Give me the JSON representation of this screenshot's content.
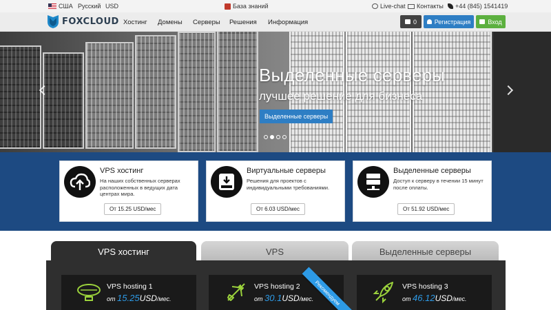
{
  "topbar": {
    "country": "США",
    "language": "Русский",
    "currency": "USD",
    "knowledge_base": "База знаний",
    "live_chat": "Live-chat",
    "contacts": "Контакты",
    "phone": "+44 (845) 1541419"
  },
  "nav": {
    "logo_text": "FOXCLOUD",
    "items": [
      "Хостинг",
      "Домены",
      "Серверы",
      "Решения",
      "Информация"
    ],
    "cart_count": "0",
    "register_label": "Регистрация",
    "login_label": "Вход"
  },
  "hero": {
    "title": "Выделенные серверы",
    "subtitle": "лучшее решение для бизнеса",
    "button_label": "Выделенные серверы",
    "slide_count": 4,
    "active_slide": 2
  },
  "features": [
    {
      "title": "VPS хостинг",
      "description": "На наших собственных серверах расположенных в ведущих дата центрах мира.",
      "price": "От 15.25 USD/мес",
      "icon": "cloud-upload-icon"
    },
    {
      "title": "Виртуальные серверы",
      "description": "Решения для проектов с индивидуальными требованиями.",
      "price": "От 6.03 USD/мес",
      "icon": "hard-drive-icon"
    },
    {
      "title": "Выделенные серверы",
      "description": "Доступ к серверу в течении 15 минут после оплаты.",
      "price": "От 51.92 USD/мес",
      "icon": "server-icon"
    }
  ],
  "tabs": [
    "VPS хостинг",
    "VPS",
    "Выделенные серверы"
  ],
  "plans": [
    {
      "name": "VPS hosting 1",
      "prefix": "от",
      "price": "15.25",
      "unit": "USD",
      "period": "/мес.",
      "icon": "airship-icon"
    },
    {
      "name": "VPS hosting 2",
      "prefix": "от",
      "price": "30.1",
      "unit": "USD",
      "period": "/мес.",
      "icon": "airplane-icon"
    },
    {
      "name": "VPS hosting 3",
      "prefix": "от",
      "price": "46.12",
      "unit": "USD",
      "period": "/мес.",
      "icon": "rocket-icon"
    }
  ],
  "recommended_label": "Рекомендуем",
  "colors": {
    "brand_blue": "#2e7ec4",
    "band_blue": "#1d4a82",
    "login_green": "#5cb03f",
    "price_blue": "#2d9ae6"
  }
}
